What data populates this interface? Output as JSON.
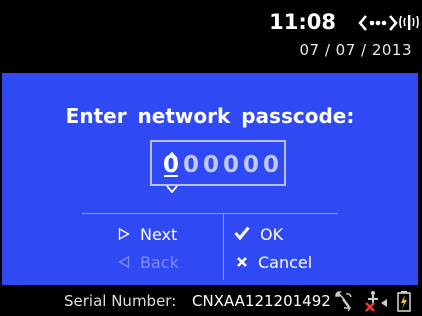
{
  "status": {
    "time": "11:08",
    "date": "07 / 07 / 2013",
    "icons": [
      "connection-dots-icon",
      "signal-icon"
    ]
  },
  "dialog": {
    "prompt": "Enter network passcode:",
    "passcode_digits": [
      "0",
      "0",
      "0",
      "0",
      "0",
      "0"
    ],
    "active_digit_index": 0,
    "actions": {
      "next": "Next",
      "back": "Back",
      "ok": "OK",
      "cancel": "Cancel"
    }
  },
  "footer": {
    "serial_label": "Serial Number:",
    "serial_value": "CNXAA121201492",
    "icons": [
      "wrench-status-icon",
      "network-error-icon",
      "battery-icon"
    ]
  },
  "colors": {
    "panel": "#2f49f4",
    "background": "#000000",
    "text": "#ffffff",
    "disabled_text": "#7d8cff",
    "error_mark": "#e53a3a",
    "battery": "#e8c54a"
  }
}
